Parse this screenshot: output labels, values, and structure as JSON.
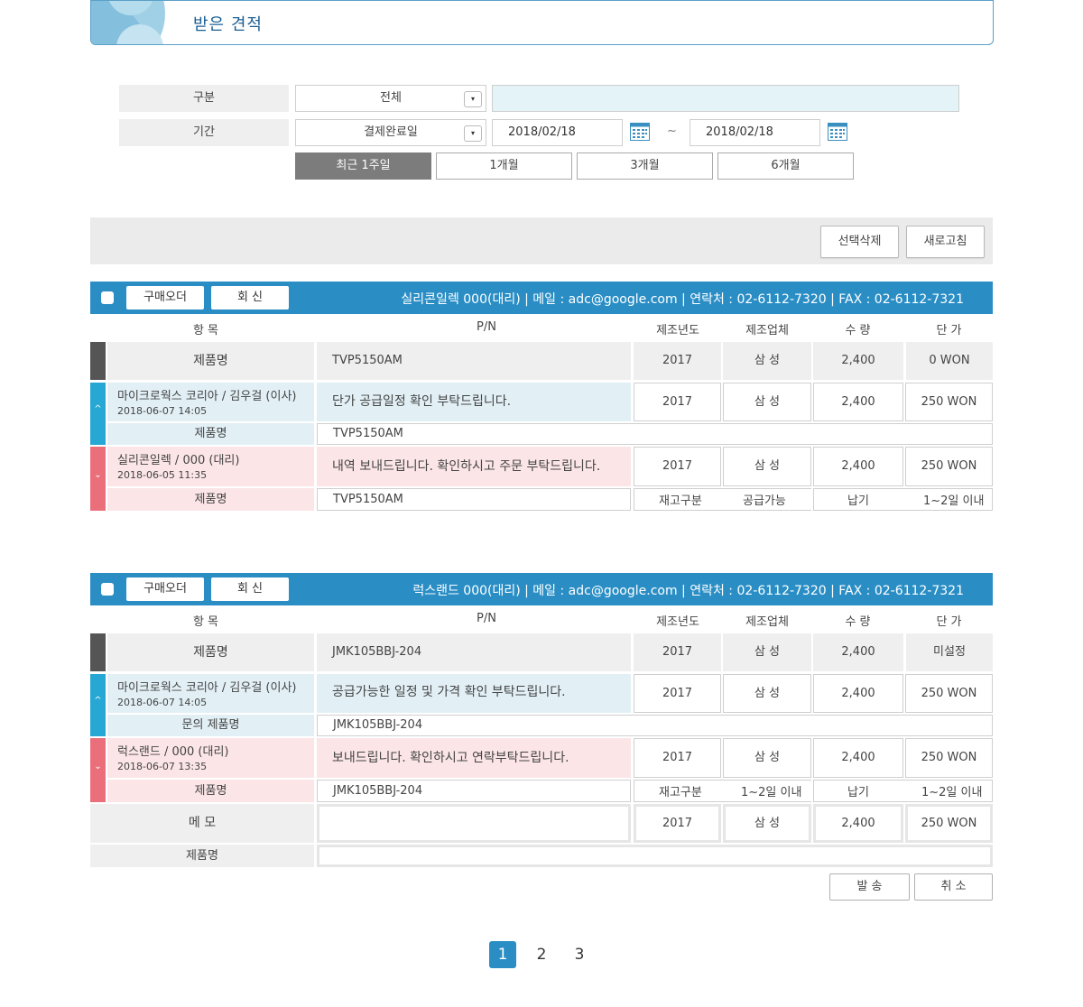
{
  "page_title": "받은 견적",
  "filter": {
    "category_label": "구분",
    "category_value": "전체",
    "period_label": "기간",
    "period_type_value": "결제완료일",
    "date_from": "2018/02/18",
    "date_to": "2018/02/18",
    "tilde": "~",
    "dropdown_arrow": "▾",
    "ranges": [
      "최근 1주일",
      "1개월",
      "3개월",
      "6개월"
    ],
    "active_range": "최근 1주일"
  },
  "actions": {
    "delete_selected": "선택삭제",
    "refresh": "새로고침"
  },
  "columns": [
    "항 목",
    "P/N",
    "제조년도",
    "제조업체",
    "수 량",
    "단 가"
  ],
  "quotes": [
    {
      "order_button": "구매오더",
      "reply_button": "회 신",
      "info": "실리콘일렉 000(대리) |   메일 : adc@google.com |   연락처 : 02-6112-7320   |  FAX : 02-6112-7321",
      "summary": {
        "label": "제품명",
        "pn": "TVP5150AM",
        "year": "2017",
        "maker": "삼 성",
        "qty": "2,400",
        "price": "0 WON"
      },
      "messages": [
        {
          "sender": "마이크로웍스 코리아 / 김우걸 (이사)",
          "date": "2018-06-07 14:05",
          "text": "단가 공급일정 확인 부탁드립니다.",
          "year": "2017",
          "maker": "삼 성",
          "qty": "2,400",
          "price": "250 WON",
          "sub_label": "제품명",
          "sub_pn": "TVP5150AM",
          "toggle": "^"
        },
        {
          "sender": "실리콘일렉 / 000 (대리)",
          "date": "2018-06-05 11:35",
          "text": "내역 보내드립니다. 확인하시고 주문 부탁드립니다.",
          "year": "2017",
          "maker": "삼 성",
          "qty": "2,400",
          "price": "250 WON",
          "sub_label": "제품명",
          "sub_pn": "TVP5150AM",
          "sub_extra": [
            "재고구분",
            "공급가능",
            "납기",
            "1~2일 이내"
          ],
          "toggle": "⌄"
        }
      ]
    },
    {
      "order_button": "구매오더",
      "reply_button": "회 신",
      "info": "럭스랜드 000(대리)     |   메일 : adc@google.com |   연락처 : 02-6112-7320   |  FAX : 02-6112-7321",
      "summary": {
        "label": "제품명",
        "pn": "JMK105BBJ-204",
        "year": "2017",
        "maker": "삼 성",
        "qty": "2,400",
        "price": "미설정"
      },
      "messages": [
        {
          "sender": "마이크로웍스 코리아 / 김우걸 (이사)",
          "date": "2018-06-07 14:05",
          "text": "공급가능한 일정 및 가격 확인 부탁드립니다.",
          "year": "2017",
          "maker": "삼 성",
          "qty": "2,400",
          "price": "250 WON",
          "sub_label": "문의 제품명",
          "sub_pn": "JMK105BBJ-204",
          "toggle": "^"
        },
        {
          "sender": "럭스랜드 / 000 (대리)",
          "date": "2018-06-07 13:35",
          "text": "보내드립니다. 확인하시고 연락부탁드립니다.",
          "year": "2017",
          "maker": "삼 성",
          "qty": "2,400",
          "price": "250 WON",
          "sub_label": "제품명",
          "sub_pn": "JMK105BBJ-204",
          "sub_extra": [
            "재고구분",
            "1~2일 이내",
            "납기",
            "1~2일 이내"
          ],
          "toggle": "⌄"
        }
      ],
      "reply_form": {
        "memo_label": "메 모",
        "year": "2017",
        "maker": "삼 성",
        "qty": "2,400",
        "price": "250 WON",
        "product_label": "제품명",
        "send_button": "발 송",
        "cancel_button": "취 소"
      }
    }
  ],
  "pagination": {
    "pages": [
      "1",
      "2",
      "3"
    ],
    "current": "1"
  }
}
